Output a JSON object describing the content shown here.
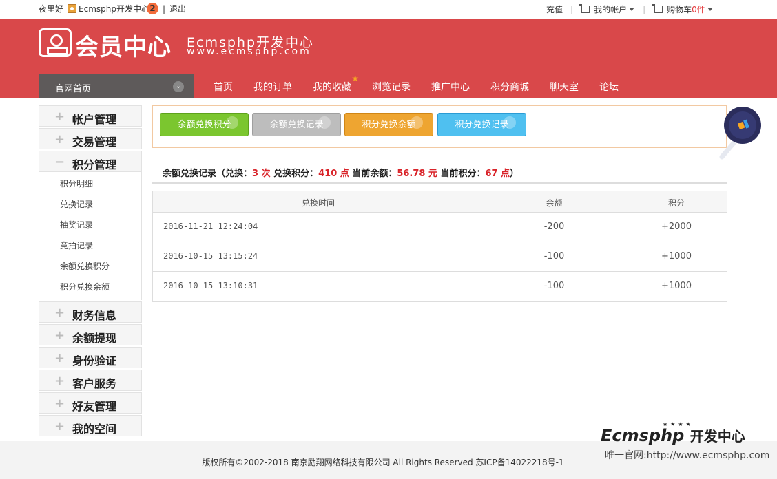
{
  "topbar": {
    "greeting": "夜里好",
    "username": "Ecmsphp开发中心",
    "notification_count": "2",
    "logout": "退出",
    "recharge": "充值",
    "my_account": "我的帐户",
    "cart_label": "购物车",
    "cart_count": "0件"
  },
  "header": {
    "logo_text": "会员中心",
    "brand": "Ecmsphp开发中心",
    "url": "www.ecmsphp.com",
    "home_dropdown": "官网首页",
    "nav": [
      "首页",
      "我的订单",
      "我的收藏",
      "浏览记录",
      "推广中心",
      "积分商城",
      "聊天室",
      "论坛"
    ]
  },
  "sidebar": {
    "groups": [
      {
        "title": "帐户管理",
        "expanded": false
      },
      {
        "title": "交易管理",
        "expanded": false
      },
      {
        "title": "积分管理",
        "expanded": true
      },
      {
        "title": "财务信息",
        "expanded": false
      },
      {
        "title": "余额提现",
        "expanded": false
      },
      {
        "title": "身份验证",
        "expanded": false
      },
      {
        "title": "客户服务",
        "expanded": false
      },
      {
        "title": "好友管理",
        "expanded": false
      },
      {
        "title": "我的空间",
        "expanded": false
      }
    ],
    "points_subitems": [
      "积分明细",
      "兑换记录",
      "抽奖记录",
      "竞拍记录",
      "余额兑换积分",
      "积分兑换余额"
    ],
    "plus": "+",
    "minus": "−"
  },
  "buttons": [
    "余额兑换积分",
    "余额兑换记录",
    "积分兑换余额",
    "积分兑换记录"
  ],
  "summary": {
    "prefix": "余额兑换记录（兑换：",
    "count": "3 次",
    "points_label": " 兑换积分：",
    "points": "410 点",
    "balance_label": " 当前余额：",
    "balance": "56.78 元",
    "current_points_label": " 当前积分：",
    "current_points": "67 点",
    "suffix": "）"
  },
  "table": {
    "headers": [
      "兑换时间",
      "余额",
      "积分"
    ],
    "rows": [
      [
        "2016-11-21 12:24:04",
        "-200",
        "+2000"
      ],
      [
        "2016-10-15 13:15:24",
        "-100",
        "+1000"
      ],
      [
        "2016-10-15 13:10:31",
        "-100",
        "+1000"
      ]
    ]
  },
  "footer": {
    "copyright": "版权所有©2002-2018 南京励翔网络科技有限公司 All Rights Reserved 苏ICP备14022218号-1"
  },
  "watermark": {
    "logo": "Ecmsphp",
    "logo_cn": "开发中心",
    "stars": "★★★★",
    "url_text": "唯一官网:http://www.ecmsphp.com"
  }
}
